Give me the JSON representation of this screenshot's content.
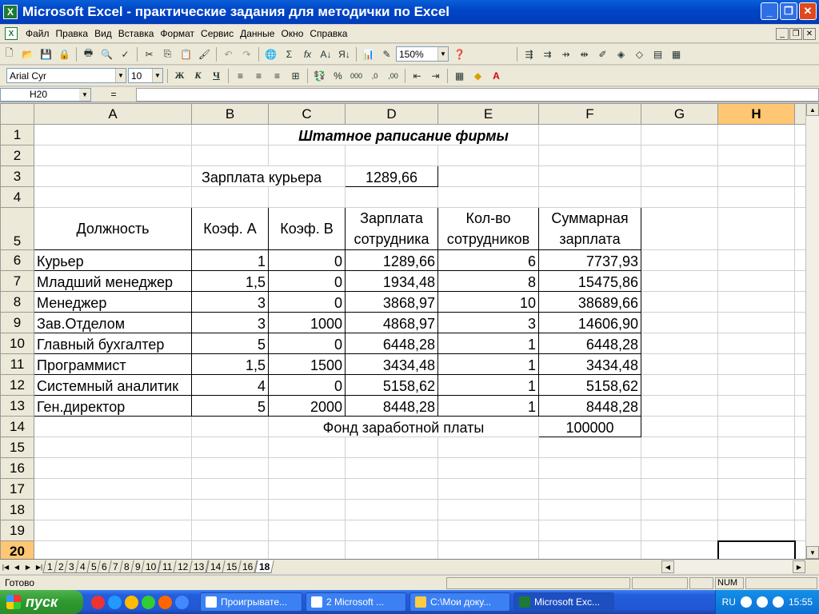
{
  "window": {
    "title": "Microsoft Excel - практические задания для методички по Excel",
    "app_icon": "X"
  },
  "menu": [
    "Файл",
    "Правка",
    "Вид",
    "Вставка",
    "Формат",
    "Сервис",
    "Данные",
    "Окно",
    "Справка"
  ],
  "toolbar1": {
    "zoom": "150%"
  },
  "toolbar2": {
    "font": "Arial Cyr",
    "size": "10"
  },
  "formula": {
    "cell": "H20",
    "eq": "=",
    "value": ""
  },
  "columns": [
    "A",
    "B",
    "C",
    "D",
    "E",
    "F",
    "G",
    "H"
  ],
  "rows": [
    "1",
    "2",
    "3",
    "4",
    "5",
    "6",
    "7",
    "8",
    "9",
    "10",
    "11",
    "12",
    "13",
    "14",
    "15",
    "16",
    "17",
    "18",
    "19",
    "20"
  ],
  "sheet": {
    "title": "Штатное раписание фирмы",
    "courier_label": "Зарплата курьера",
    "courier_value": "1289,66",
    "headers": [
      "Должность",
      "Коэф. А",
      "Коэф. В",
      "Зарплата сотрудника",
      "Кол-во сотрудников",
      "Суммарная зарплата"
    ],
    "data": [
      [
        "Курьер",
        "1",
        "0",
        "1289,66",
        "6",
        "7737,93"
      ],
      [
        "Младший менеджер",
        "1,5",
        "0",
        "1934,48",
        "8",
        "15475,86"
      ],
      [
        "Менеджер",
        "3",
        "0",
        "3868,97",
        "10",
        "38689,66"
      ],
      [
        "Зав.Отделом",
        "3",
        "1000",
        "4868,97",
        "3",
        "14606,90"
      ],
      [
        "Главный бухгалтер",
        "5",
        "0",
        "6448,28",
        "1",
        "6448,28"
      ],
      [
        "Программист",
        "1,5",
        "1500",
        "3434,48",
        "1",
        "3434,48"
      ],
      [
        "Системный аналитик",
        "4",
        "0",
        "5158,62",
        "1",
        "5158,62"
      ],
      [
        "Ген.директор",
        "5",
        "2000",
        "8448,28",
        "1",
        "8448,28"
      ]
    ],
    "fund_label": "Фонд заработной платы",
    "fund_value": "100000"
  },
  "tabs": [
    "1",
    "2",
    "3",
    "4",
    "5",
    "6",
    "7",
    "8",
    "9",
    "10",
    "11",
    "12",
    "13",
    "14",
    "15",
    "16",
    "18"
  ],
  "active_tab": "18",
  "status": {
    "text": "Готово",
    "num": "NUM"
  },
  "taskbar": {
    "start": "пуск",
    "tasks": [
      "Проигрывате...",
      "2 Microsoft ...",
      "C:\\Мои доку...",
      "Microsoft Exc..."
    ],
    "lang": "RU",
    "time": "15:55"
  }
}
